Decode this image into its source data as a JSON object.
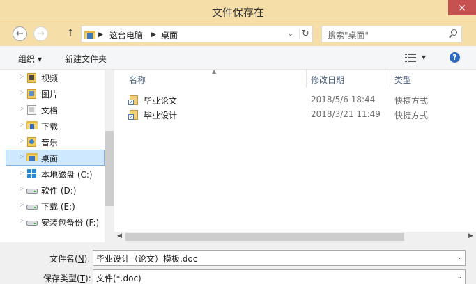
{
  "window": {
    "title": "文件保存在",
    "close_glyph": "×"
  },
  "address": {
    "back_glyph": "←",
    "forward_glyph": "→",
    "up_glyph": "↑",
    "crumbs": [
      "这台电脑",
      "桌面"
    ],
    "dropdown_glyph": "⌄",
    "refresh_glyph": "↻"
  },
  "search": {
    "placeholder": "搜索\"桌面\""
  },
  "toolbar": {
    "organize_label": "组织",
    "new_folder_label": "新建文件夹",
    "help_glyph": "?"
  },
  "nav": {
    "items": [
      {
        "label": "视频",
        "icon": "library-video-icon"
      },
      {
        "label": "图片",
        "icon": "library-pictures-icon"
      },
      {
        "label": "文档",
        "icon": "library-documents-icon"
      },
      {
        "label": "下载",
        "icon": "downloads-icon"
      },
      {
        "label": "音乐",
        "icon": "library-music-icon"
      },
      {
        "label": "桌面",
        "icon": "desktop-icon",
        "selected": true
      },
      {
        "label": "本地磁盘 (C:)",
        "icon": "windows-drive-icon"
      },
      {
        "label": "软件 (D:)",
        "icon": "drive-icon"
      },
      {
        "label": "下载 (E:)",
        "icon": "drive-icon"
      },
      {
        "label": "安装包备份 (F:)",
        "icon": "drive-icon"
      }
    ]
  },
  "columns": {
    "name": "名称",
    "modified": "修改日期",
    "type": "类型"
  },
  "files": [
    {
      "name": "毕业论文",
      "modified": "2018/5/6 18:44",
      "type": "快捷方式"
    },
    {
      "name": "毕业设计",
      "modified": "2018/3/21 11:49",
      "type": "快捷方式"
    }
  ],
  "form": {
    "filename_label_pre": "文件名(",
    "filename_label_key": "N",
    "filename_label_post": "):",
    "filename_value": "毕业设计（论文）模板.doc",
    "filetype_label_pre": "保存类型(",
    "filetype_label_key": "T",
    "filetype_label_post": "):",
    "filetype_value": "文件(*.doc)"
  },
  "colors": {
    "titlebar": "#f5dea8",
    "selection": "#cde8ff",
    "header_text": "#4c607a"
  }
}
